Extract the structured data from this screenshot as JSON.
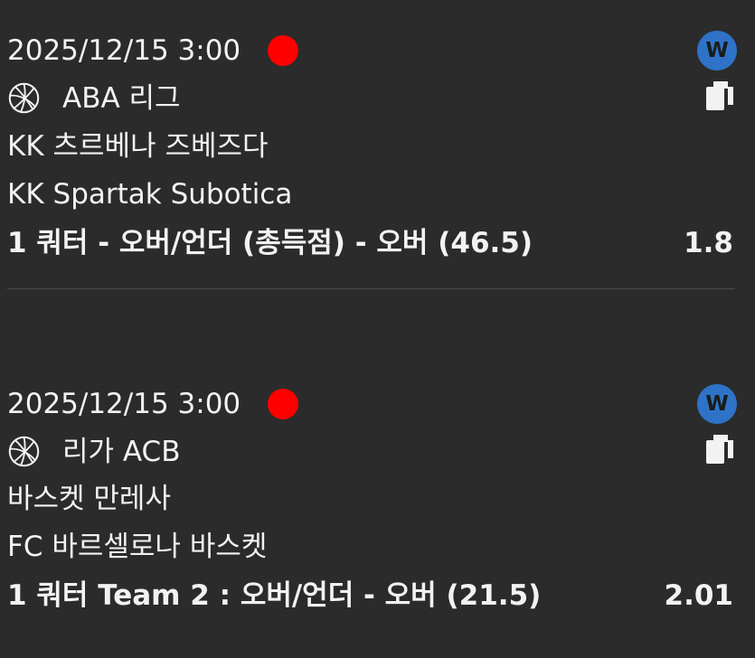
{
  "bets": [
    {
      "datetime": "2025/12/15 3:00",
      "league_icon": "basketball-icon",
      "league": "ABA 리그",
      "home_team": "KK 츠르베나 즈베즈다",
      "away_team": "KK Spartak Subotica",
      "selection": "1 쿼터 - 오버/언더 (총득점) - 오버 (46.5)",
      "odds": "1.8",
      "badge": "W"
    },
    {
      "datetime": "2025/12/15 3:00",
      "league_icon": "basketball-icon",
      "league": "리가 ACB",
      "home_team": "바스켓 만레사",
      "away_team": "FC 바르셀로나 바스켓",
      "selection": "1 쿼터 Team 2 : 오버/언더 - 오버 (21.5)",
      "odds": "2.01",
      "badge": "W"
    }
  ],
  "colors": {
    "background": "#2b2b2b",
    "text": "#f2f2f2",
    "live_dot": "#ff0000",
    "badge": "#2e73c8",
    "divider": "#4a4a4a"
  }
}
